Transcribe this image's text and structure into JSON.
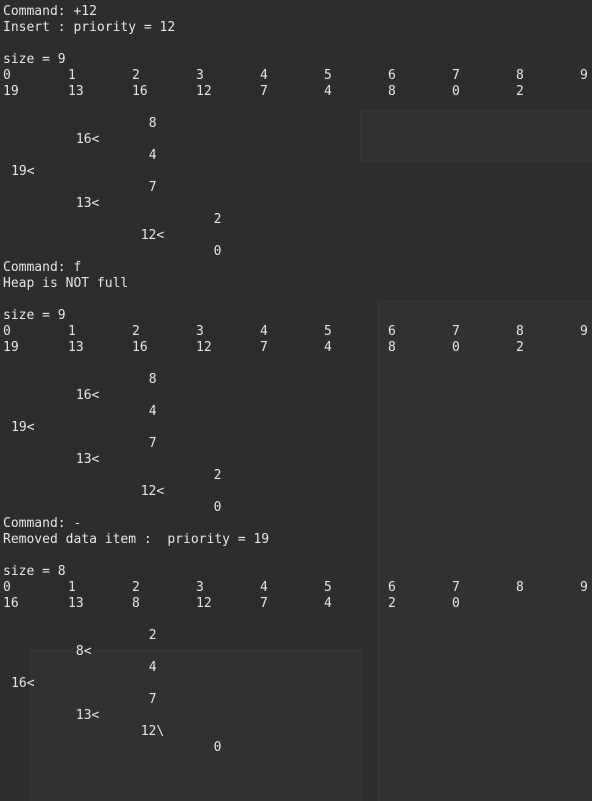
{
  "sections": [
    {
      "command": "Command: +12",
      "message": "Insert : priority = 12",
      "size": "size = 9",
      "indices": [
        "0",
        "1",
        "2",
        "3",
        "4",
        "5",
        "6",
        "7",
        "8",
        "9"
      ],
      "values": [
        "19",
        "13",
        "16",
        "12",
        "7",
        "4",
        "8",
        "0",
        "2"
      ],
      "tree": [
        {
          "text": "8",
          "col": 18
        },
        {
          "text": "16<",
          "col": 9
        },
        {
          "text": "4",
          "col": 18
        },
        {
          "text": "19<",
          "col": 1
        },
        {
          "text": "7",
          "col": 18
        },
        {
          "text": "13<",
          "col": 9
        },
        {
          "text": "2",
          "col": 26
        },
        {
          "text": "12<",
          "col": 17
        },
        {
          "text": "0",
          "col": 26
        }
      ]
    },
    {
      "command": "Command: f",
      "message": "Heap is NOT full",
      "size": "size = 9",
      "indices": [
        "0",
        "1",
        "2",
        "3",
        "4",
        "5",
        "6",
        "7",
        "8",
        "9"
      ],
      "values": [
        "19",
        "13",
        "16",
        "12",
        "7",
        "4",
        "8",
        "0",
        "2"
      ],
      "tree": [
        {
          "text": "8",
          "col": 18
        },
        {
          "text": "16<",
          "col": 9
        },
        {
          "text": "4",
          "col": 18
        },
        {
          "text": "19<",
          "col": 1
        },
        {
          "text": "7",
          "col": 18
        },
        {
          "text": "13<",
          "col": 9
        },
        {
          "text": "2",
          "col": 26
        },
        {
          "text": "12<",
          "col": 17
        },
        {
          "text": "0",
          "col": 26
        }
      ]
    },
    {
      "command": "Command: -",
      "message": "Removed data item :  priority = 19",
      "size": "size = 8",
      "indices": [
        "0",
        "1",
        "2",
        "3",
        "4",
        "5",
        "6",
        "7",
        "8",
        "9"
      ],
      "values": [
        "16",
        "13",
        "8",
        "12",
        "7",
        "4",
        "2",
        "0"
      ],
      "tree": [
        {
          "text": "2",
          "col": 18
        },
        {
          "text": "8<",
          "col": 9
        },
        {
          "text": "4",
          "col": 18
        },
        {
          "text": "16<",
          "col": 1
        },
        {
          "text": "7",
          "col": 18
        },
        {
          "text": "13<",
          "col": 9
        },
        {
          "text": "12\\",
          "col": 17
        },
        {
          "text": "0",
          "col": 26
        }
      ]
    }
  ]
}
